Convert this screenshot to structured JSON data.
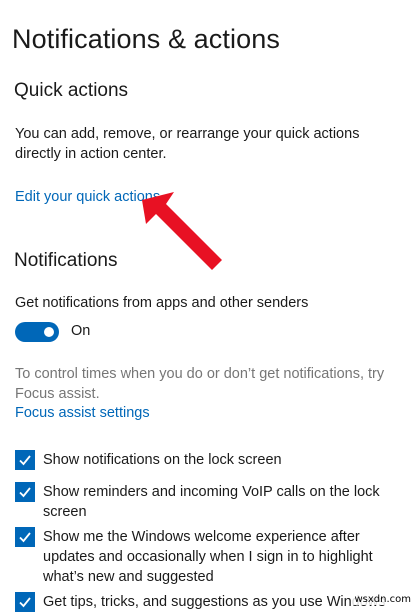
{
  "page": {
    "title": "Notifications & actions"
  },
  "quick_actions": {
    "heading": "Quick actions",
    "description": "You can add, remove, or rearrange your quick actions directly in action center.",
    "edit_link": "Edit your quick actions"
  },
  "notifications": {
    "heading": "Notifications",
    "get_notifications_label": "Get notifications from apps and other senders",
    "toggle": {
      "state": "On",
      "enabled": true
    },
    "focus_text": "To control times when you do or don’t get notifications, try Focus assist.",
    "focus_link": "Focus assist settings",
    "options": [
      {
        "label": "Show notifications on the lock screen",
        "checked": true
      },
      {
        "label": "Show reminders and incoming VoIP calls on the lock screen",
        "checked": true
      },
      {
        "label": "Show me the Windows welcome experience after updates and occasionally when I sign in to highlight what’s new and suggested",
        "checked": true
      },
      {
        "label": "Get tips, tricks, and suggestions as you use Windows",
        "checked": true
      }
    ]
  },
  "annotation": {
    "arrow_color": "#e81123"
  },
  "watermark": "wsxdn.com",
  "colors": {
    "accent": "#0067b8",
    "muted_text": "#767676"
  }
}
